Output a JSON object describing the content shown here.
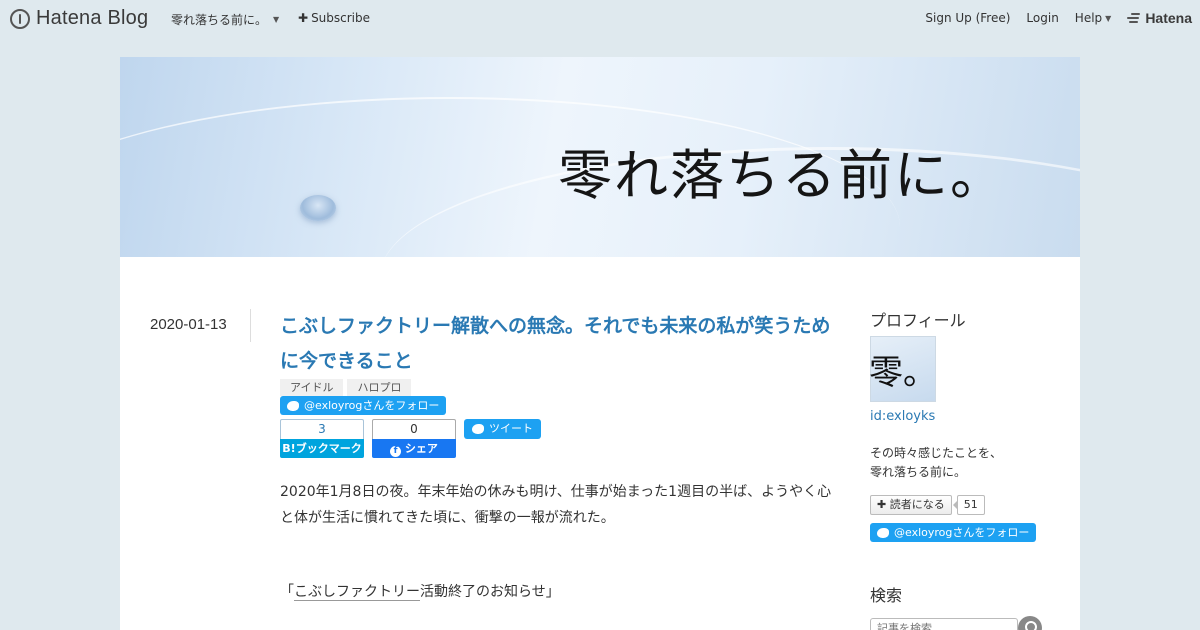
{
  "topbar": {
    "logo_text": "Hatena Blog",
    "blog_name": "零れ落ちる前に。",
    "subscribe_label": "Subscribe",
    "signup_label": "Sign Up (Free)",
    "login_label": "Login",
    "help_label": "Help",
    "brand_label": "Hatena"
  },
  "banner": {
    "title": "零れ落ちる前に。"
  },
  "entry": {
    "date": "2020-01-13",
    "title": "こぶしファクトリー解散への無念。それでも未来の私が笑うために今できること",
    "tags": [
      "アイドル",
      "ハロプロ"
    ],
    "twitter_follow_label": "@exloyrogさんをフォロー",
    "hatena_bookmark_count": "3",
    "hatena_bookmark_label": "B!ブックマーク",
    "facebook_count": "0",
    "facebook_label": "シェア",
    "tweet_label": "ツイート",
    "body_paragraph": "2020年1月8日の夜。年末年始の休みも明け、仕事が始まった1週目の半ば、ようやく心と体が生活に慣れてきた頃に、衝撃の一報が流れた。",
    "quote_open": "「",
    "quote_link": "こぶしファクトリー",
    "quote_rest": "活動終了のお知らせ」"
  },
  "sidebar": {
    "profile_heading": "プロフィール",
    "avatar_char": "零。",
    "profile_id": "id:exloyks",
    "profile_desc_line1": "その時々感じたことを、",
    "profile_desc_line2": "零れ落ちる前に。",
    "reader_button_label": "読者になる",
    "reader_count": "51",
    "twitter_follow_label": "@exloyrogさんをフォロー",
    "search_heading": "検索",
    "search_placeholder": "記事を検索"
  },
  "icons": {
    "logo": "hatena-blog-logo-icon",
    "dropdown": "chevron-down-icon",
    "plus": "plus-icon",
    "twitter": "twitter-bird-icon",
    "search": "magnifier-icon"
  },
  "colors": {
    "background": "#dfe9ee",
    "link": "#2a79b3",
    "twitter": "#1da1f2",
    "hatena_bookmark": "#00a4de",
    "facebook": "#1877f2"
  }
}
